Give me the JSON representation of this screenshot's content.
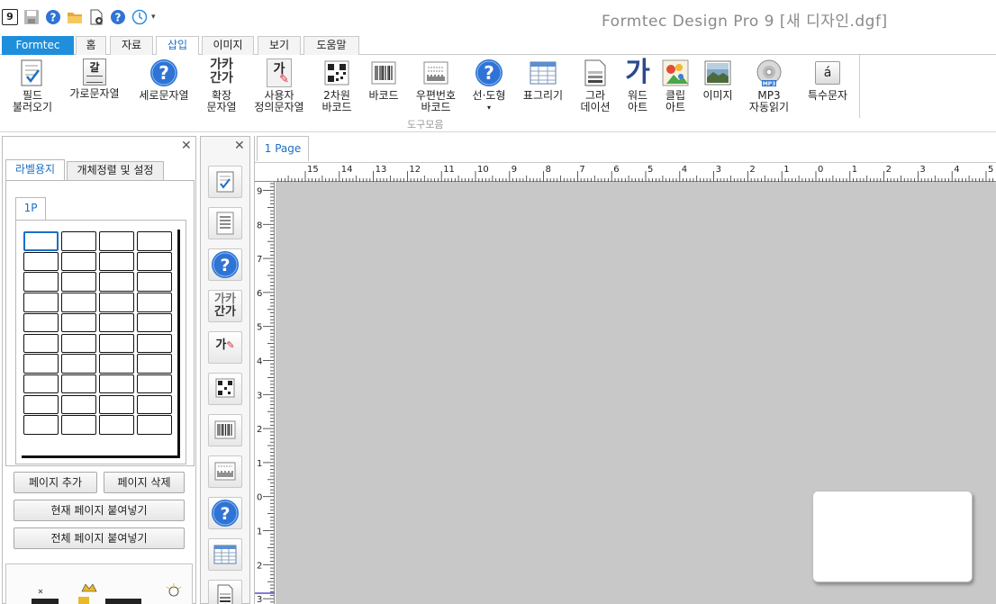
{
  "title_bar": {
    "app_title": "Formtec Design Pro 9 [새 디자인.dgf]",
    "quick_access": [
      "app-logo-icon",
      "save-icon",
      "help-icon",
      "open-folder-icon",
      "new-document-icon",
      "help-icon",
      "update-icon",
      "dropdown-icon"
    ],
    "logo_text": "9"
  },
  "ribbon": {
    "tabs": [
      {
        "label": "Formtec",
        "active": false
      },
      {
        "label": "홈",
        "active": false
      },
      {
        "label": "자료",
        "active": false
      },
      {
        "label": "삽입",
        "active": true
      },
      {
        "label": "이미지",
        "active": false
      },
      {
        "label": "보기",
        "active": false
      },
      {
        "label": "도움말",
        "active": false
      }
    ],
    "buttons": [
      {
        "line1": "필드",
        "line2": "불러오기",
        "icon": "field-load-icon"
      },
      {
        "line1": "가로문자열",
        "line2": "",
        "icon": "horizontal-text-icon"
      },
      {
        "line1": "세로문자열",
        "line2": "",
        "icon": "help-icon"
      },
      {
        "line1": "확장",
        "line2": "문자열",
        "icon": "extended-text-icon"
      },
      {
        "line1": "사용자",
        "line2": "정의문자열",
        "icon": "custom-text-icon"
      },
      {
        "line1": "2차원",
        "line2": "바코드",
        "icon": "qrcode-icon"
      },
      {
        "line1": "바코드",
        "line2": "",
        "icon": "barcode-icon"
      },
      {
        "line1": "우편번호",
        "line2": "바코드",
        "icon": "postal-barcode-icon"
      },
      {
        "line1": "선·도형",
        "line2": "▾",
        "icon": "help-icon"
      },
      {
        "line1": "표그리기",
        "line2": "",
        "icon": "table-icon"
      },
      {
        "line1": "그라",
        "line2": "데이션",
        "icon": "gradation-icon"
      },
      {
        "line1": "워드",
        "line2": "아트",
        "icon": "wordart-icon"
      },
      {
        "line1": "클립",
        "line2": "아트",
        "icon": "clipart-icon"
      },
      {
        "line1": "이미지",
        "line2": "",
        "icon": "image-icon"
      },
      {
        "line1": "MP3",
        "line2": "자동읽기",
        "icon": "mp3-icon"
      },
      {
        "line1": "특수문자",
        "line2": "",
        "icon": "special-char-icon"
      }
    ],
    "group_label": "도구모음",
    "wordart_glyph": "가",
    "extended_glyph_top": "가카",
    "extended_glyph_bottom": "간가",
    "custom_glyph": "가",
    "horizontal_glyph": "갈",
    "special_glyph": "á",
    "mp3_badge": "MP3"
  },
  "left_panel": {
    "tabs": [
      {
        "label": "라벨용지",
        "active": true
      },
      {
        "label": "개체정렬 및 설정",
        "active": false
      }
    ],
    "page_tab": "1P",
    "buttons": {
      "add_page": "페이지 추가",
      "delete_page": "페이지 삭제",
      "paste_current": "현재 페이지 붙여넣기",
      "paste_all": "전체 페이지 붙여넣기"
    },
    "grid": {
      "columns": 4,
      "rows": 10
    }
  },
  "design": {
    "page_tab": "1 Page",
    "h_ruler_labels": [
      "15",
      "14",
      "13",
      "12",
      "11",
      "10",
      "9",
      "8",
      "7",
      "6",
      "5",
      "4",
      "3",
      "2",
      "1",
      "0",
      "1",
      "2",
      "3",
      "4",
      "5"
    ],
    "v_ruler_labels": [
      "9",
      "8",
      "7",
      "6",
      "5",
      "4",
      "3",
      "2",
      "1",
      "0",
      "1",
      "2",
      "3"
    ]
  },
  "colors": {
    "accent": "#1c6fc4",
    "formtec_tab": "#1f8fdc",
    "canvas": "#c8c8c8"
  }
}
